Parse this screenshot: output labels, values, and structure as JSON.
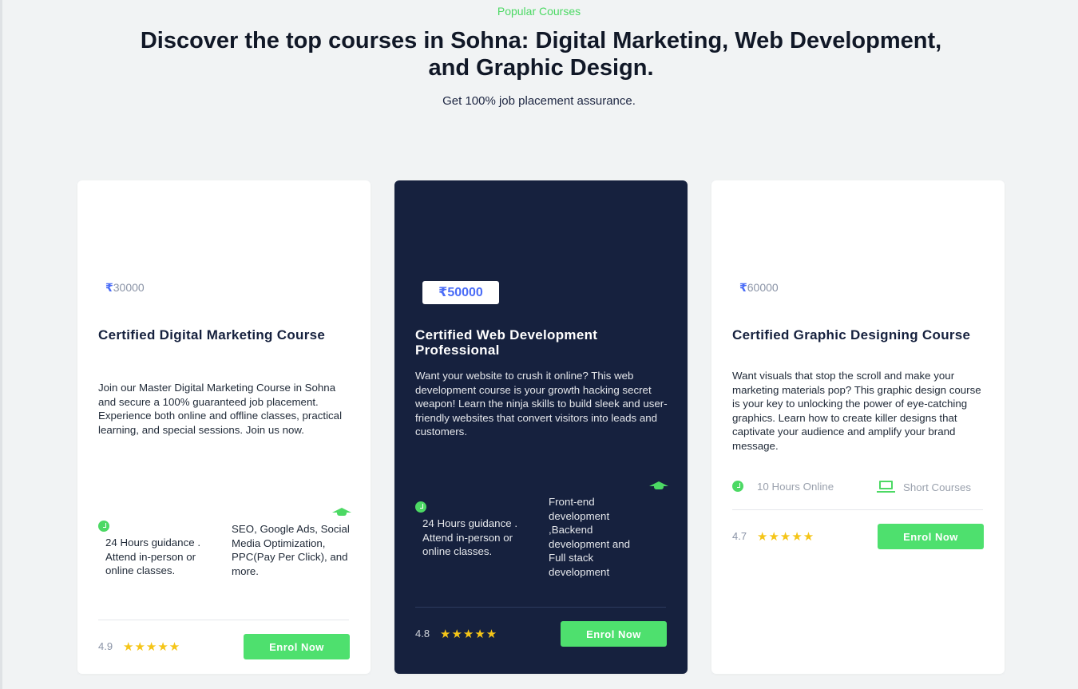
{
  "section": {
    "eyebrow": "Popular Courses",
    "heading": "Discover the top courses in Sohna: Digital Marketing, Web Development, and Graphic Design.",
    "subheading": "Get 100% job placement assurance."
  },
  "colors": {
    "accent": "#4cd964",
    "dark_card": "#16213e",
    "price": "#4a6cf7",
    "star": "#f5c518"
  },
  "courses": [
    {
      "price_symbol": "₹",
      "price": "30000",
      "title": "Certified Digital Marketing Course",
      "description": "Join our Master Digital Marketing Course in Sohna and secure a 100% guaranteed job placement. Experience both online and offline classes, practical learning, and special sessions. Join us now.",
      "guidance": "24 Hours guidance . Attend in-person or online classes.",
      "topics": "SEO, Google Ads, Social Media Optimization, PPC(Pay Per Click), and more.",
      "rating": "4.9",
      "stars": "★★★★★",
      "button": "Enrol Now",
      "icons": [
        "clock-icon",
        "graduation-cap-icon"
      ]
    },
    {
      "price_symbol": "₹",
      "price": "50000",
      "title": "Certified Web Development Professional",
      "description": "Want your website to crush it online?  This web development course is your growth hacking secret weapon!  Learn the ninja skills to build sleek and user-friendly websites that convert visitors into leads and customers.",
      "guidance": "24 Hours guidance . Attend in-person or online classes.",
      "topics": "Front-end development ,Backend development and Full stack development",
      "rating": "4.8",
      "stars": "★★★★★",
      "button": "Enrol Now",
      "icons": [
        "clock-icon",
        "graduation-cap-icon"
      ]
    },
    {
      "price_symbol": "₹",
      "price": "60000",
      "title": "Certified Graphic Designing Course",
      "description": "Want visuals that stop the scroll and make your marketing materials pop? This graphic design course is your key to unlocking the power of eye-catching graphics. Learn how to create killer designs that captivate your audience and amplify your brand message.",
      "duration": "10 Hours Online",
      "format": "Short Courses",
      "rating": "4.7",
      "stars": "★★★★★",
      "button": "Enrol Now",
      "icons": [
        "clock-icon",
        "laptop-icon"
      ]
    }
  ]
}
